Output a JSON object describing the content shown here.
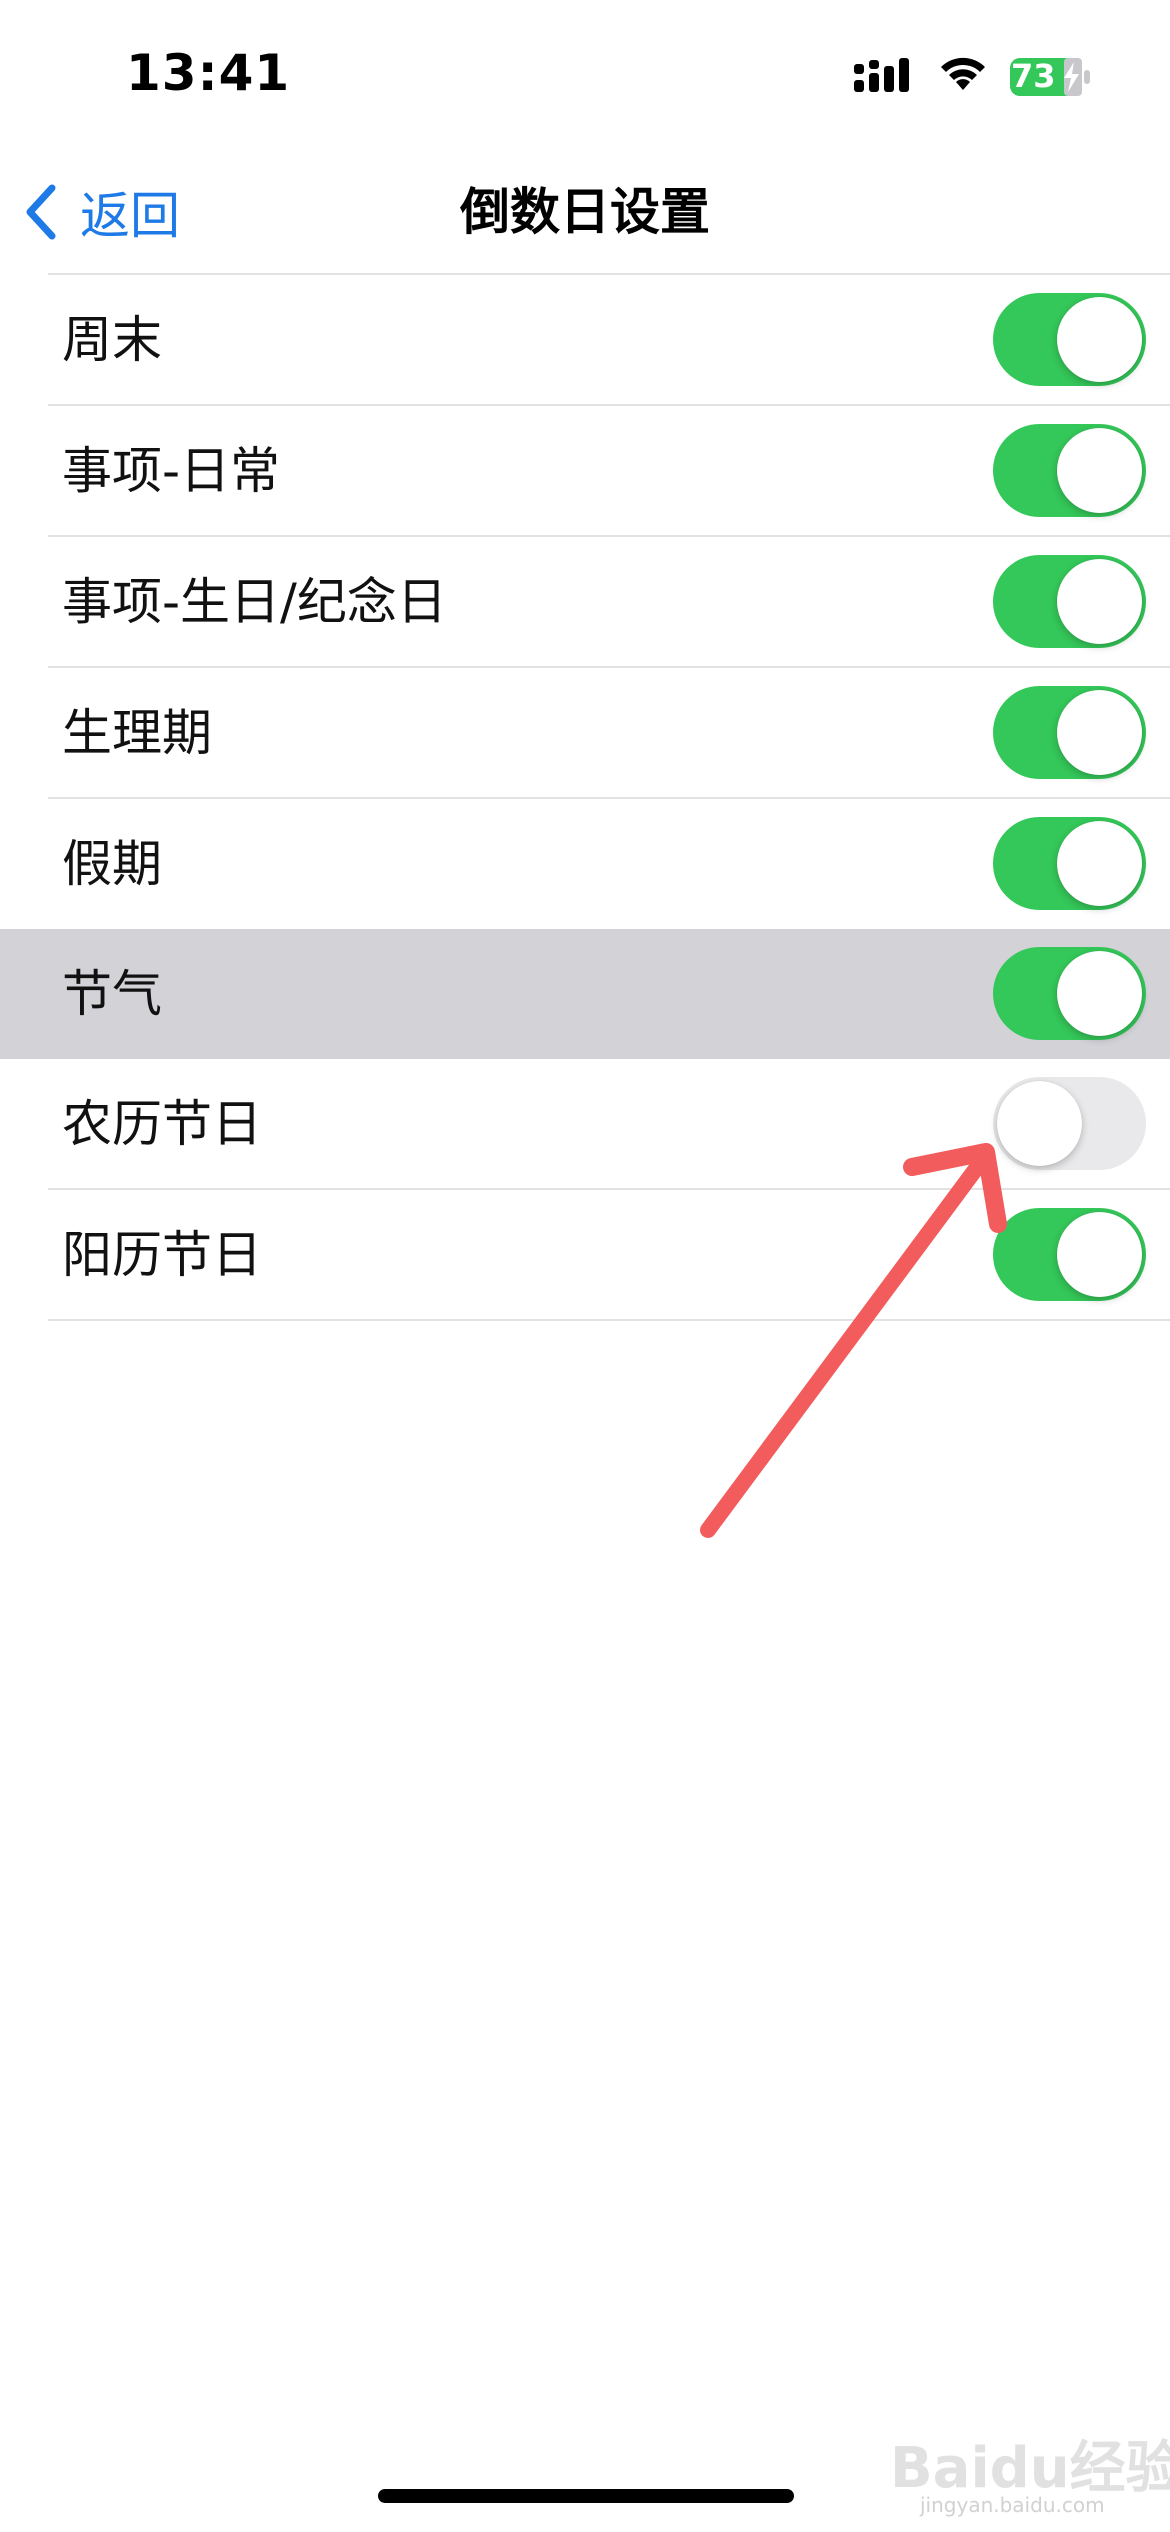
{
  "status_bar": {
    "time": "13:41",
    "battery_level": "73",
    "battery_color": "#34c759",
    "icons": [
      "signal-icon",
      "wifi-icon",
      "battery-charging-icon"
    ]
  },
  "nav": {
    "back_label": "返回",
    "title": "倒数日设置",
    "back_icon": "chevron-left-icon",
    "accent_color": "#1e7ae6"
  },
  "settings": {
    "toggle_on_color": "#34c759",
    "toggle_off_color": "#e9e9eb",
    "items": [
      {
        "label": "周末",
        "on": true,
        "highlighted": false
      },
      {
        "label": "事项-日常",
        "on": true,
        "highlighted": false
      },
      {
        "label": "事项-生日/纪念日",
        "on": true,
        "highlighted": false
      },
      {
        "label": "生理期",
        "on": true,
        "highlighted": false
      },
      {
        "label": "假期",
        "on": true,
        "highlighted": false
      },
      {
        "label": "节气",
        "on": true,
        "highlighted": true
      },
      {
        "label": "农历节日",
        "on": false,
        "highlighted": false
      },
      {
        "label": "阳历节日",
        "on": true,
        "highlighted": false
      }
    ]
  },
  "annotation": {
    "icon": "red-arrow-icon",
    "color": "#f25c5c",
    "target": "农历节日"
  },
  "watermark": {
    "text": "Baidu经验",
    "sub": "jingyan.baidu.com"
  }
}
